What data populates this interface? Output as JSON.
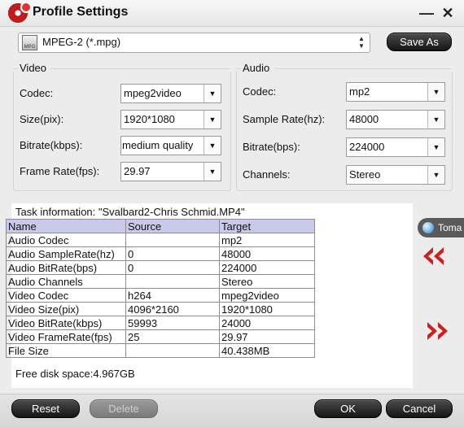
{
  "window": {
    "title": "Profile Settings",
    "minimize_glyph": "—",
    "close_glyph": "✕"
  },
  "format": {
    "icon_label": "MPG",
    "value": "MPEG-2 (*.mpg)"
  },
  "save_as_label": "Save As",
  "video": {
    "title": "Video",
    "fields": [
      {
        "label": "Codec:",
        "value": "mpeg2video"
      },
      {
        "label": "Size(pix):",
        "value": "1920*1080"
      },
      {
        "label": "Bitrate(kbps):",
        "value": "medium quality"
      },
      {
        "label": "Frame Rate(fps):",
        "value": "29.97"
      }
    ]
  },
  "audio": {
    "title": "Audio",
    "fields": [
      {
        "label": "Codec:",
        "value": "mp2"
      },
      {
        "label": "Sample Rate(hz):",
        "value": "48000"
      },
      {
        "label": "Bitrate(bps):",
        "value": "224000"
      },
      {
        "label": "Channels:",
        "value": "Stereo"
      }
    ]
  },
  "task": {
    "info": "Task information: \"Svalbard2-Chris Schmid.MP4\"",
    "headers": [
      "Name",
      "Source",
      "Target"
    ],
    "rows": [
      [
        "Audio Codec",
        "",
        "mp2"
      ],
      [
        "Audio SampleRate(hz)",
        "0",
        "48000"
      ],
      [
        "Audio BitRate(bps)",
        "0",
        "224000"
      ],
      [
        "Audio Channels",
        "",
        "Stereo"
      ],
      [
        "Video Codec",
        "h264",
        "mpeg2video"
      ],
      [
        "Video Size(pix)",
        "4096*2160",
        "1920*1080"
      ],
      [
        "Video BitRate(kbps)",
        "59993",
        "24000"
      ],
      [
        "Video FrameRate(fps)",
        "25",
        "29.97"
      ],
      [
        "File Size",
        "",
        "40.438MB"
      ]
    ],
    "free_disk": "Free disk space:4.967GB"
  },
  "side_tab": {
    "label": "Toma",
    "icon": "globe-icon"
  },
  "buttons": {
    "reset": "Reset",
    "delete": "Delete",
    "ok": "OK",
    "cancel": "Cancel"
  },
  "colors": {
    "accent_red": "#c8231f",
    "table_header": "#c9c9ec",
    "dark_button": "#1e1e1e"
  }
}
